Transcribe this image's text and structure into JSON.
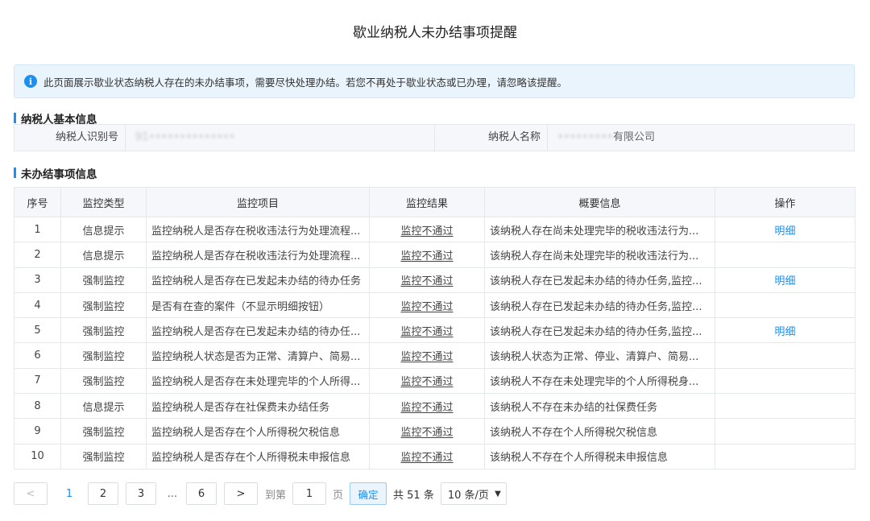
{
  "page_title": "歇业纳税人未办结事项提醒",
  "notice": {
    "icon": "info-icon",
    "text": "此页面展示歇业状态纳税人存在的未办结事项，需要尽快处理办结。若您不再处于歇业状态或已办理，请忽略该提醒。"
  },
  "basic_info": {
    "section_title": "纳税人基本信息",
    "taxpayer_id_label": "纳税人识别号",
    "taxpayer_id_value": "91••••••••••••••",
    "taxpayer_name_label": "纳税人名称",
    "taxpayer_name_masked": "•••••••••",
    "taxpayer_name_suffix": "有限公司"
  },
  "matters": {
    "section_title": "未办结事项信息",
    "columns": [
      "序号",
      "监控类型",
      "监控项目",
      "监控结果",
      "概要信息",
      "操作"
    ],
    "rows": [
      {
        "no": "1",
        "type": "信息提示",
        "item": "监控纳税人是否存在税收违法行为处理流程...",
        "result": "监控不通过",
        "summary": "该纳税人存在尚未处理完毕的税收违法行为...",
        "op": "明细"
      },
      {
        "no": "2",
        "type": "信息提示",
        "item": "监控纳税人是否存在税收违法行为处理流程...",
        "result": "监控不通过",
        "summary": "该纳税人存在尚未处理完毕的税收违法行为...",
        "op": ""
      },
      {
        "no": "3",
        "type": "强制监控",
        "item": "监控纳税人是否存在已发起未办结的待办任务",
        "result": "监控不通过",
        "summary": "该纳税人存在已发起未办结的待办任务,监控...",
        "op": "明细"
      },
      {
        "no": "4",
        "type": "强制监控",
        "item": "是否有在查的案件（不显示明细按钮）",
        "result": "监控不通过",
        "summary": "该纳税人存在已发起未办结的待办任务,监控...",
        "op": ""
      },
      {
        "no": "5",
        "type": "强制监控",
        "item": "监控纳税人是否存在已发起未办结的待办任...",
        "result": "监控不通过",
        "summary": "该纳税人存在已发起未办结的待办任务,监控...",
        "op": "明细"
      },
      {
        "no": "6",
        "type": "强制监控",
        "item": "监控纳税人状态是否为正常、清算户、简易...",
        "result": "监控不通过",
        "summary": "该纳税人状态为正常、停业、清算户、简易...",
        "op": ""
      },
      {
        "no": "7",
        "type": "强制监控",
        "item": "监控纳税人是否存在未处理完毕的个人所得...",
        "result": "监控不通过",
        "summary": "该纳税人不存在未处理完毕的个人所得税身...",
        "op": ""
      },
      {
        "no": "8",
        "type": "信息提示",
        "item": "监控纳税人是否存在社保费未办结任务",
        "result": "监控不通过",
        "summary": "该纳税人不存在未办结的社保费任务",
        "op": ""
      },
      {
        "no": "9",
        "type": "强制监控",
        "item": "监控纳税人是否存在个人所得税欠税信息",
        "result": "监控不通过",
        "summary": "该纳税人不存在个人所得税欠税信息",
        "op": ""
      },
      {
        "no": "10",
        "type": "强制监控",
        "item": "监控纳税人是否存在个人所得税未申报信息",
        "result": "监控不通过",
        "summary": "该纳税人不存在个人所得税未申报信息",
        "op": ""
      }
    ]
  },
  "pagination": {
    "prev": "<",
    "next": ">",
    "current": "1",
    "pages": [
      "2",
      "3"
    ],
    "ellipsis": "...",
    "last": "6",
    "jump_prefix": "到第",
    "jump_value": "1",
    "jump_suffix": "页",
    "confirm": "确定",
    "total": "共 51 条",
    "page_size": "10 条/页"
  },
  "colors": {
    "accent": "#1f8ef1",
    "fail": "#e32121",
    "notice_bg": "#eaf4fd"
  }
}
